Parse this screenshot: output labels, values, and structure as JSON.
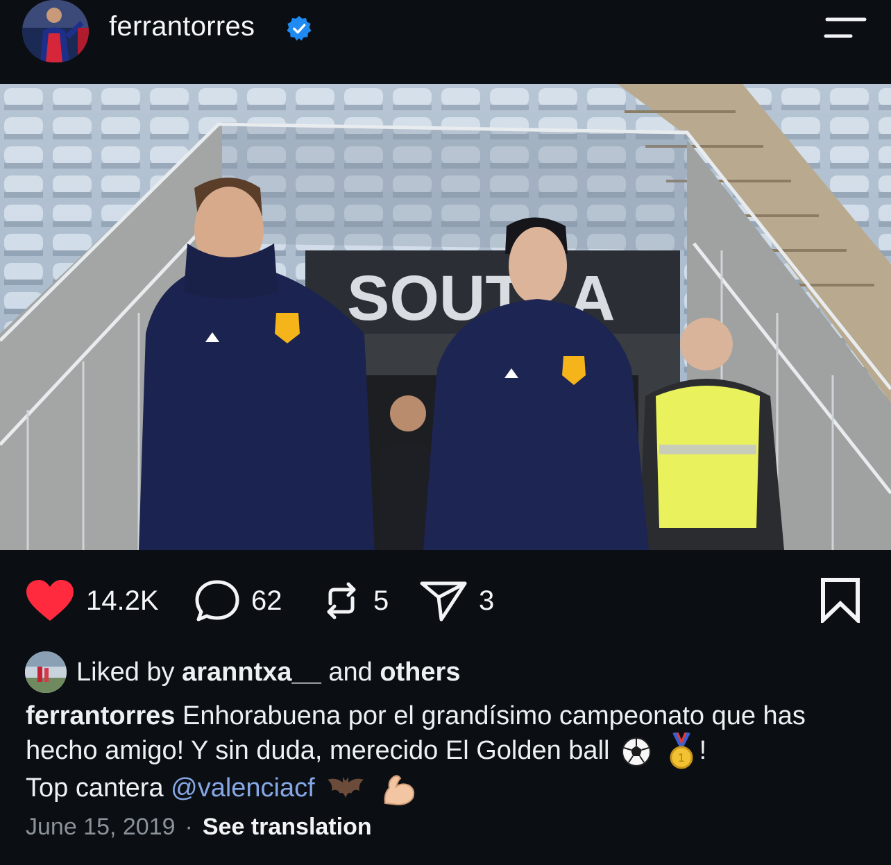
{
  "post": {
    "username": "ferrantorres",
    "verified_icon": "verified-badge-icon",
    "menu_icon": "menu-icon"
  },
  "stats": {
    "likes": "14.2K",
    "comments": "62",
    "reposts": "5",
    "shares": "3"
  },
  "liked_by": {
    "prefix": "Liked by",
    "user": "aranntxa__",
    "conjunction": "and",
    "others": "others"
  },
  "caption": {
    "author": "ferrantorres",
    "text_1": "Enhorabuena por el grandísimo campeonato que has hecho amigo! Y sin duda, merecido El Golden ball",
    "text_2": "!",
    "text_3": "Top cantera",
    "mention": "@valenciacf"
  },
  "footer": {
    "date": "June 15, 2019",
    "separator": "·",
    "translate": "See translation"
  },
  "colors": {
    "background": "#0b0f13",
    "like_red": "#ff2a3d",
    "verified_blue": "#1f8bf2",
    "mention_blue": "#86a7e6",
    "muted": "#8b929a"
  }
}
